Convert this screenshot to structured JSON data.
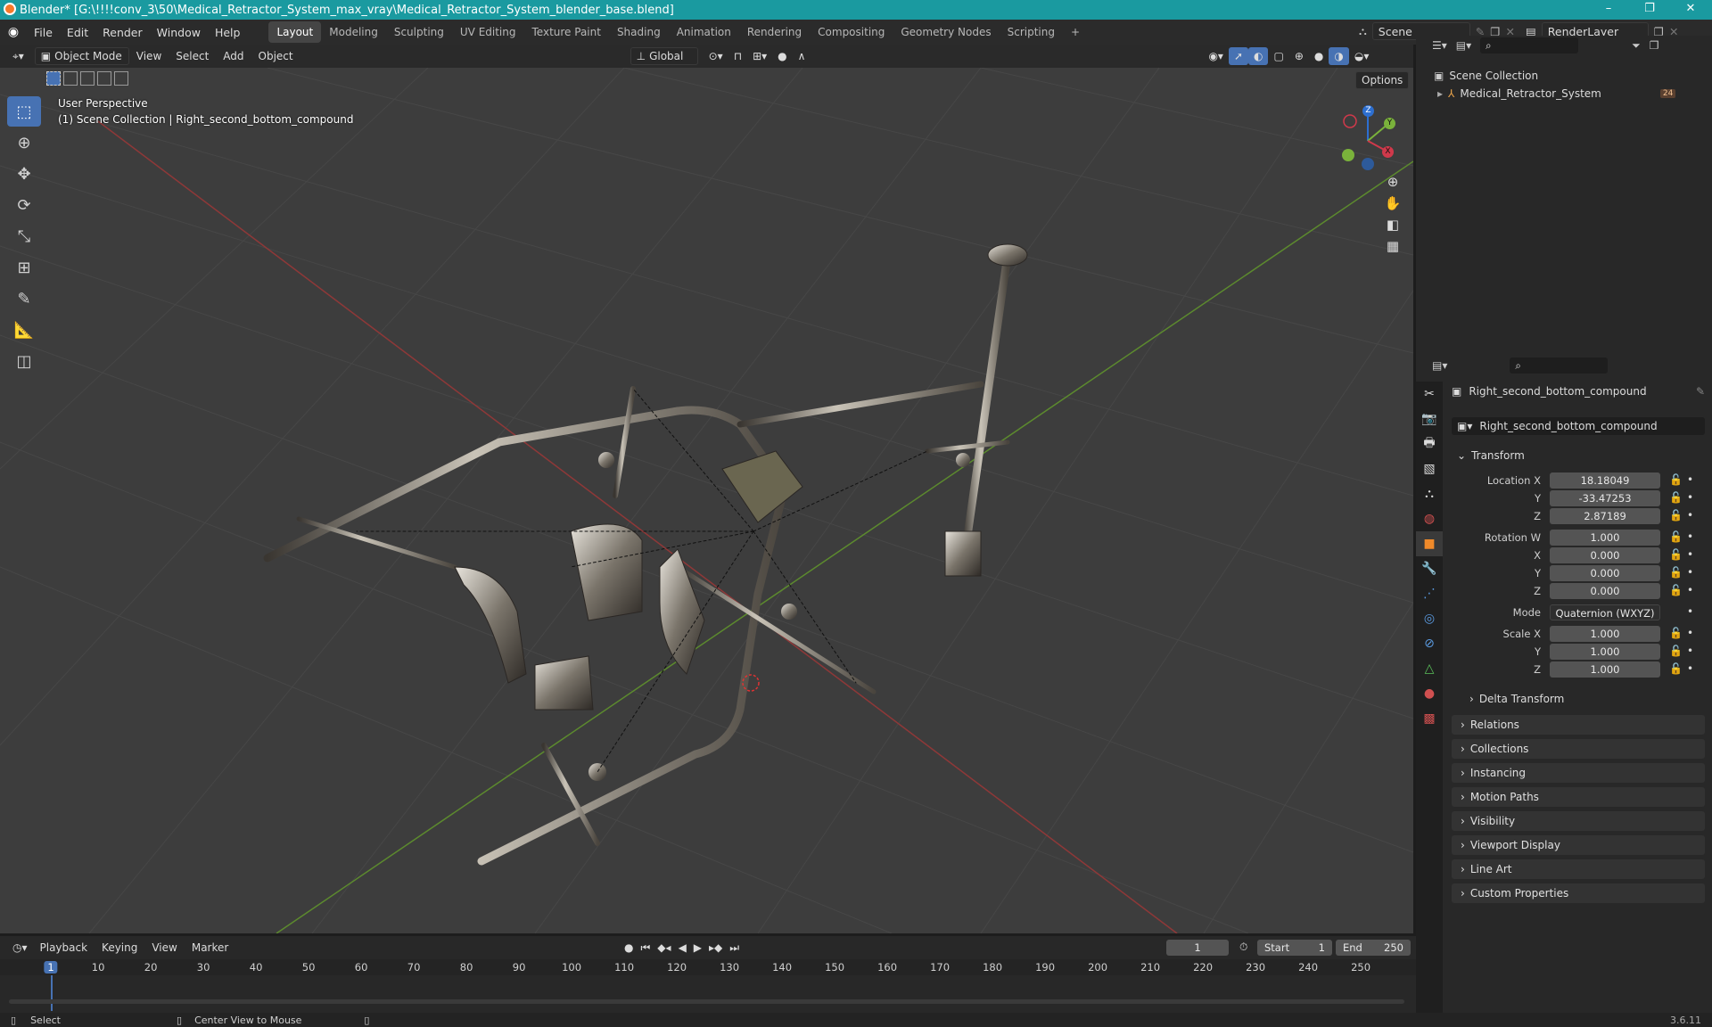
{
  "window": {
    "title": "Blender* [G:\\!!!!conv_3\\50\\Medical_Retractor_System_max_vray\\Medical_Retractor_System_blender_base.blend]",
    "minimize": "–",
    "maximize": "❐",
    "close": "✕"
  },
  "menu": {
    "items": [
      "File",
      "Edit",
      "Render",
      "Window",
      "Help"
    ]
  },
  "workspaces": [
    "Layout",
    "Modeling",
    "Sculpting",
    "UV Editing",
    "Texture Paint",
    "Shading",
    "Animation",
    "Rendering",
    "Compositing",
    "Geometry Nodes",
    "Scripting",
    "+"
  ],
  "scene": {
    "name": "Scene",
    "render_layer": "RenderLayer"
  },
  "viewport_header": {
    "mode": "Object Mode",
    "menus": [
      "View",
      "Select",
      "Add",
      "Object"
    ],
    "orientation": "Global",
    "options": "Options"
  },
  "viewport": {
    "perspective": "User Perspective",
    "collection_path": "(1) Scene Collection | Right_second_bottom_compound",
    "gizmo": {
      "z": "Z",
      "y": "Y",
      "x": "X"
    }
  },
  "outliner": {
    "root": "Scene Collection",
    "items": [
      {
        "name": "Medical_Retractor_System",
        "badge": "24"
      }
    ]
  },
  "properties": {
    "object_name": "Right_second_bottom_compound",
    "data_name": "Right_second_bottom_compound",
    "transform_label": "Transform",
    "location": {
      "label_x": "Location X",
      "label_y": "Y",
      "label_z": "Z",
      "x": "18.18049",
      "y": "-33.47253",
      "z": "2.87189"
    },
    "rotation": {
      "label_w": "Rotation W",
      "label_x": "X",
      "label_y": "Y",
      "label_z": "Z",
      "w": "1.000",
      "x": "0.000",
      "y": "0.000",
      "z": "0.000"
    },
    "mode_label": "Mode",
    "mode_value": "Quaternion (WXYZ)",
    "scale": {
      "label_x": "Scale X",
      "label_y": "Y",
      "label_z": "Z",
      "x": "1.000",
      "y": "1.000",
      "z": "1.000"
    },
    "delta": "Delta Transform",
    "panels": [
      "Relations",
      "Collections",
      "Instancing",
      "Motion Paths",
      "Visibility",
      "Viewport Display",
      "Line Art",
      "Custom Properties"
    ]
  },
  "timeline": {
    "menus": [
      "Playback",
      "Keying",
      "View",
      "Marker"
    ],
    "current_frame": "1",
    "start_label": "Start",
    "start": "1",
    "end_label": "End",
    "end": "250",
    "ticks": [
      "1",
      "10",
      "20",
      "30",
      "40",
      "50",
      "60",
      "70",
      "80",
      "90",
      "100",
      "110",
      "120",
      "130",
      "140",
      "150",
      "160",
      "170",
      "180",
      "190",
      "200",
      "210",
      "220",
      "230",
      "240",
      "250"
    ]
  },
  "status": {
    "select": "Select",
    "center": "Center View to Mouse",
    "version": "3.6.11"
  }
}
